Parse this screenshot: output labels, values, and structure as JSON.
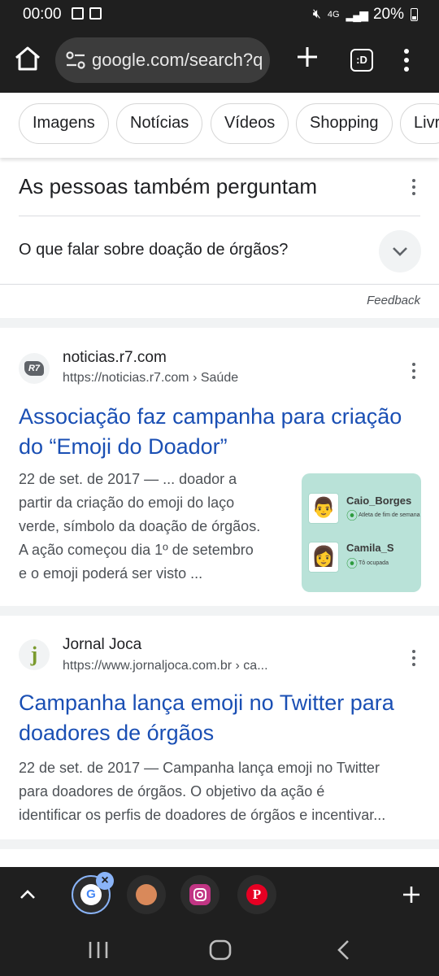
{
  "status_bar": {
    "time": "00:00",
    "network": "4G",
    "battery": "20%"
  },
  "toolbar": {
    "url": "google.com/search?q",
    "tabs_label": ":D"
  },
  "chips": [
    "Imagens",
    "Notícias",
    "Vídeos",
    "Shopping",
    "Livr"
  ],
  "paa": {
    "title": "As pessoas também perguntam",
    "question": "O que falar sobre doação de órgãos?",
    "feedback": "Feedback"
  },
  "results": [
    {
      "favicon_text": "R7",
      "site": "noticias.r7.com",
      "url": "https://noticias.r7.com",
      "breadcrumb": "› Saúde",
      "title_lines": [
        "Associação faz campanha para criação",
        "do “Emoji do Doador”"
      ],
      "snippet_lines": [
        "22 de set. de 2017 — ... doador a",
        "partir da criação do emoji do laço",
        "verde, símbolo da doação de órgãos.",
        "A ação começou dia 1º de setembro",
        "e o emoji poderá ser visto ..."
      ],
      "thumb": {
        "user1": "Caio_Borges",
        "tag1": "Atleta de fim de semana",
        "user2": "Camila_S",
        "tag2": "Tô ocupada"
      }
    },
    {
      "favicon_text": "j",
      "site": "Jornal Joca",
      "url": "https://www.jornaljoca.com.br",
      "breadcrumb": "› ca...",
      "title_lines": [
        "Campanha lança emoji no Twitter para",
        "doadores de órgãos"
      ],
      "snippet_lines": [
        "22 de set. de 2017 — Campanha lança emoji no Twitter",
        "para doadores de órgãos. O objetivo da ação é",
        "identificar os perfis de doadores de órgãos e incentivar..."
      ]
    }
  ],
  "colors": {
    "link": "#1a4fb4",
    "chrome_bg": "#1f1f1f",
    "separator": "#f1f3f4"
  },
  "bottom_tabs": {
    "icons": [
      "google-icon",
      "profile-icon",
      "instagram-icon",
      "pinterest-icon"
    ]
  }
}
